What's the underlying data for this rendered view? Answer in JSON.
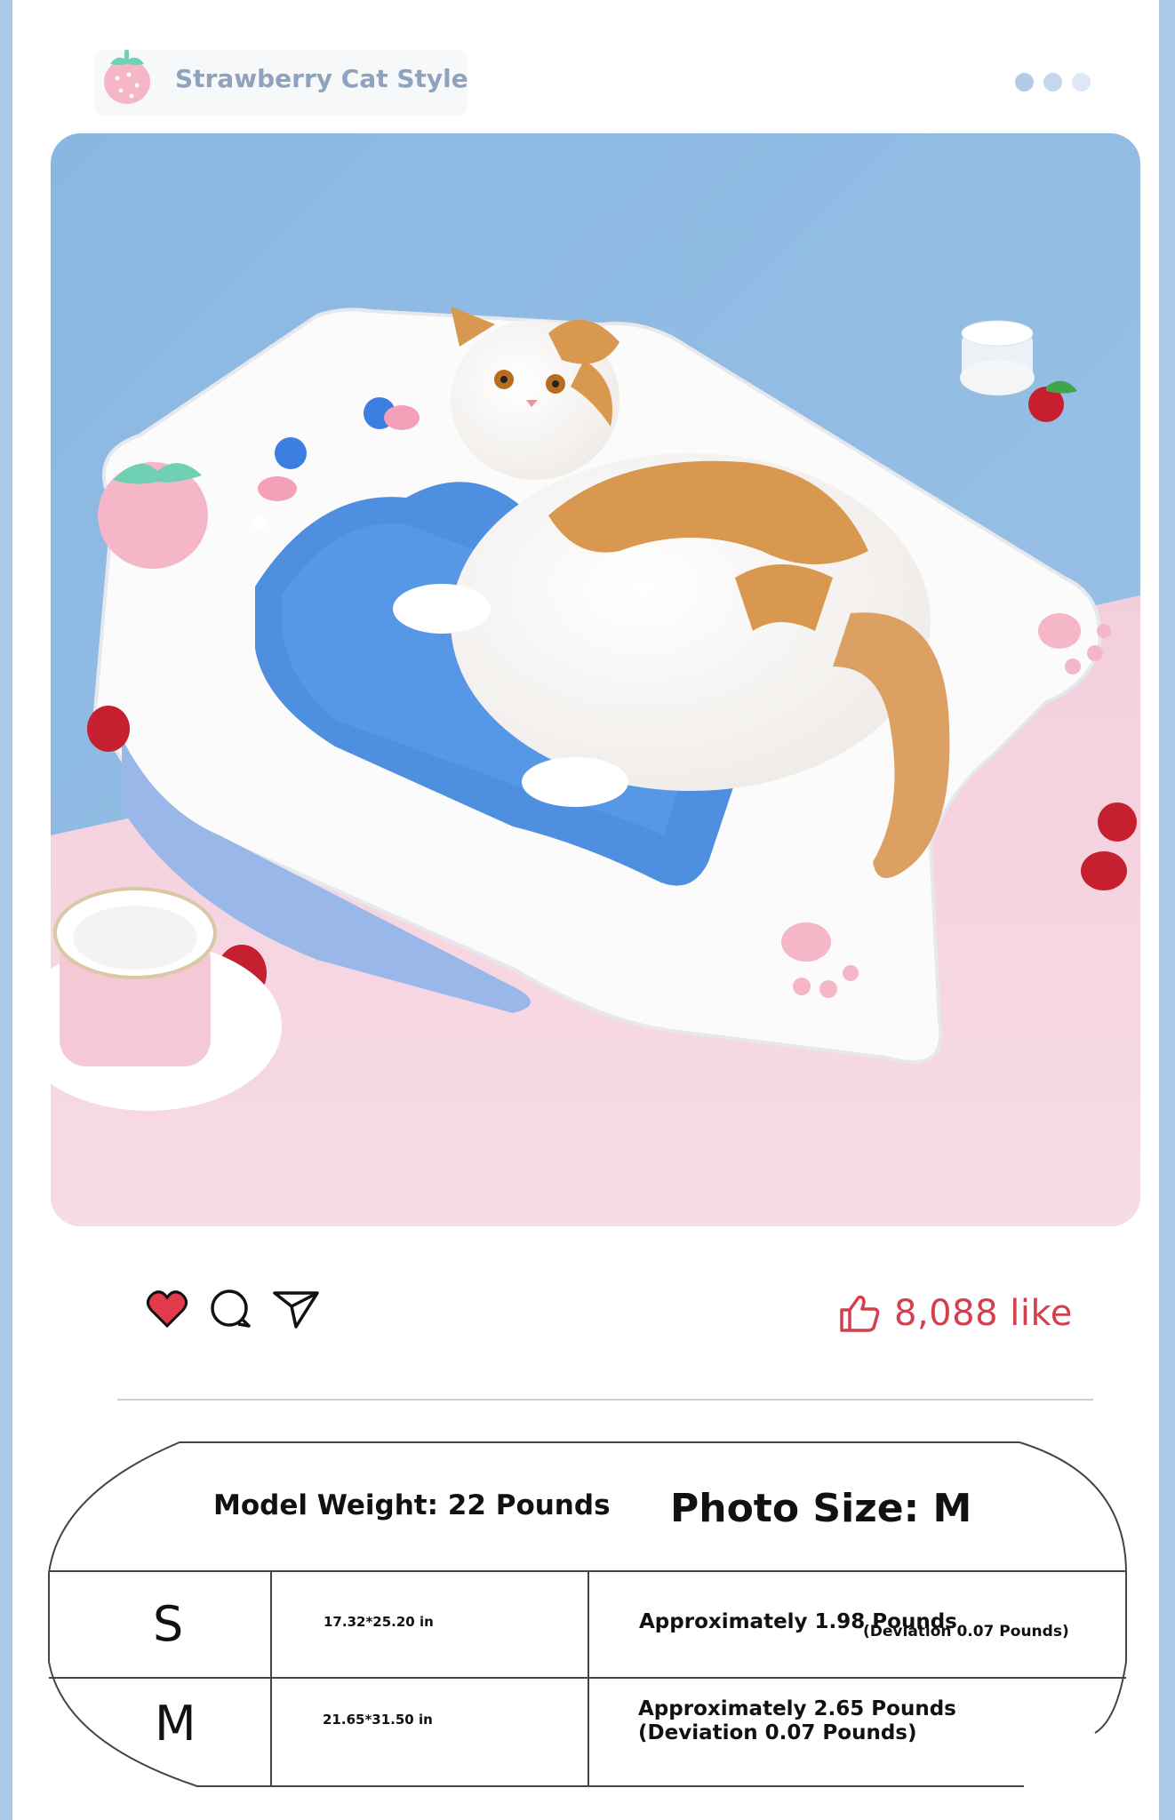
{
  "header": {
    "brand": "Strawberry Cat Style",
    "logo_icon": "strawberry-icon",
    "menu_dots": [
      "#b3cbe6",
      "#c5d7ec",
      "#dde8f4"
    ]
  },
  "actions": {
    "like_icon": "heart-icon",
    "comment_icon": "comment-icon",
    "share_icon": "send-icon",
    "thumbs_icon": "thumbs-up-icon",
    "like_count": "8,088 like",
    "accent": "#d2404f"
  },
  "size_table": {
    "model_weight": "Model Weight: 22 Pounds",
    "photo_size": "Photo Size: M",
    "rows": [
      {
        "size": "S",
        "dimensions": "17.32*25.20 in",
        "weight": "Approximately 1.98 Pounds",
        "deviation": "(Deviation 0.07 Pounds)"
      },
      {
        "size": "M",
        "dimensions": "21.65*31.50 in",
        "weight": "Approximately 2.65 Pounds",
        "deviation": "(Deviation 0.07 Pounds)"
      }
    ]
  }
}
